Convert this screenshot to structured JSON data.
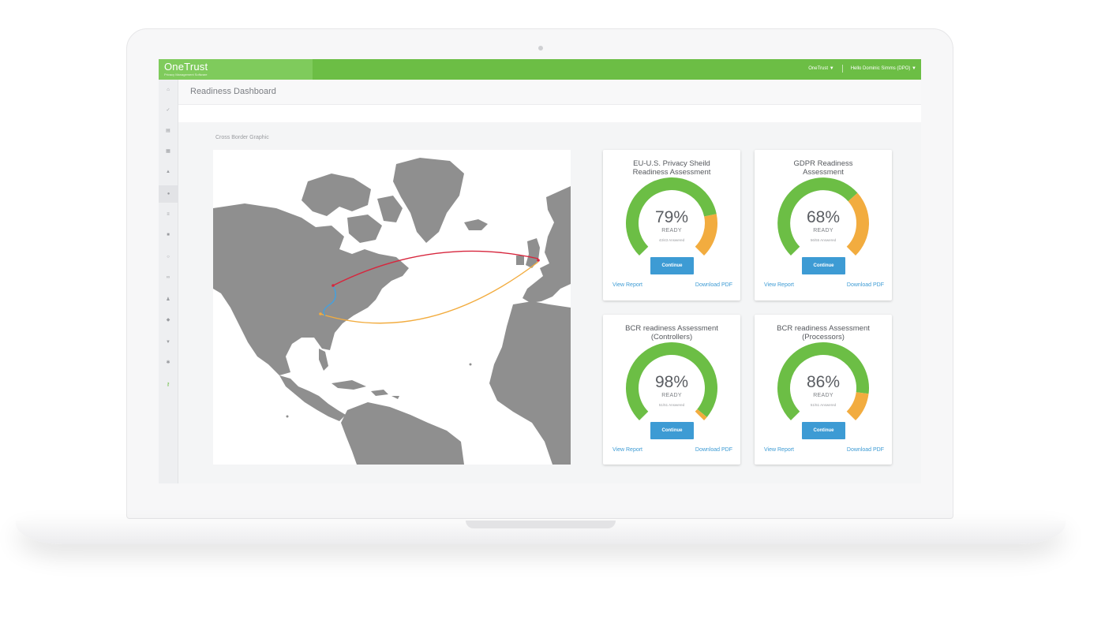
{
  "app": {
    "brand": "OneTrust",
    "brand_subtitle": "Privacy Management Software",
    "nav_org": "OneTrust",
    "nav_user": "Hello Dominic Simms (DPO)"
  },
  "page": {
    "title": "Readiness Dashboard",
    "section_label": "Cross Border Graphic"
  },
  "colors": {
    "green": "#6cbe45",
    "orange": "#f2ac3f",
    "blue": "#3d9bd4",
    "red": "#d7263d",
    "map_land": "#8f8f8f"
  },
  "sidebar_icons": [
    "home-icon",
    "check-icon",
    "document-icon",
    "grid-icon",
    "building-icon",
    "globe-icon",
    "list-icon",
    "briefcase-icon",
    "clock-icon",
    "link-icon",
    "user-icon",
    "shield-icon",
    "filter-icon",
    "gear-icon",
    "key-icon"
  ],
  "cards": [
    {
      "title_line1": "EU-U.S. Privacy Sheild",
      "title_line2": "Readiness Assessment",
      "percent": 79,
      "percent_label": "79%",
      "ready_label": "READY",
      "answered": "43/43 Answered",
      "button": "Continue",
      "view_report": "View Report",
      "download_pdf": "Download PDF"
    },
    {
      "title_line1": "GDPR Readiness",
      "title_line2": "Assessment",
      "percent": 68,
      "percent_label": "68%",
      "ready_label": "READY",
      "answered": "56/55 Answered",
      "button": "Continue",
      "view_report": "View Report",
      "download_pdf": "Download PDF"
    },
    {
      "title_line1": "BCR readiness Assessment",
      "title_line2": "(Controllers)",
      "percent": 98,
      "percent_label": "98%",
      "ready_label": "READY",
      "answered": "51/51 Answered",
      "button": "Continue",
      "view_report": "View Report",
      "download_pdf": "Download PDF"
    },
    {
      "title_line1": "BCR readiness Assessment",
      "title_line2": "(Processors)",
      "percent": 86,
      "percent_label": "86%",
      "ready_label": "READY",
      "answered": "51/51 Answered",
      "button": "Continue",
      "view_report": "View Report",
      "download_pdf": "Download PDF"
    }
  ]
}
